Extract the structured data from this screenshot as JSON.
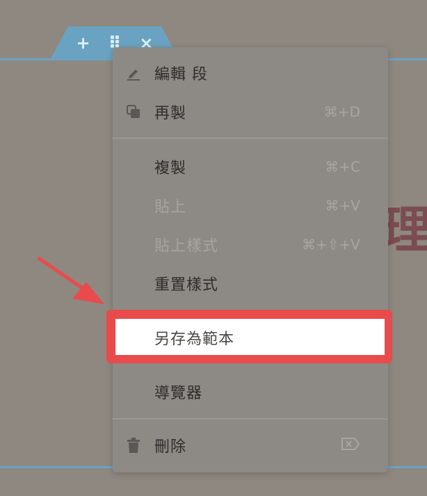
{
  "section_toolbar": {
    "add_symbol": "+",
    "drag_symbol": "⠿",
    "close_symbol": "×"
  },
  "background_heading_char": "理",
  "context_menu": {
    "items": [
      {
        "label": "編輯 段",
        "icon": "pencil-icon",
        "shortcut": ""
      },
      {
        "label": "再製",
        "icon": "duplicate-icon",
        "shortcut": "⌘+D"
      },
      {
        "label": "複製",
        "icon": "",
        "shortcut": "⌘+C"
      },
      {
        "label": "貼上",
        "icon": "",
        "shortcut": "⌘+V",
        "disabled": true
      },
      {
        "label": "貼上樣式",
        "icon": "",
        "shortcut": "⌘+⇧+V",
        "disabled": true
      },
      {
        "label": "重置樣式",
        "icon": "",
        "shortcut": ""
      },
      {
        "label": "另存為範本",
        "icon": "",
        "shortcut": "",
        "highlighted": true
      },
      {
        "label": "導覽器",
        "icon": "",
        "shortcut": ""
      },
      {
        "label": "刪除",
        "icon": "trash-icon",
        "shortcut_icon": "delete-key-icon"
      }
    ]
  },
  "annotation": {
    "arrow_color": "#e94a4c",
    "highlight_color": "#e94a4c"
  }
}
